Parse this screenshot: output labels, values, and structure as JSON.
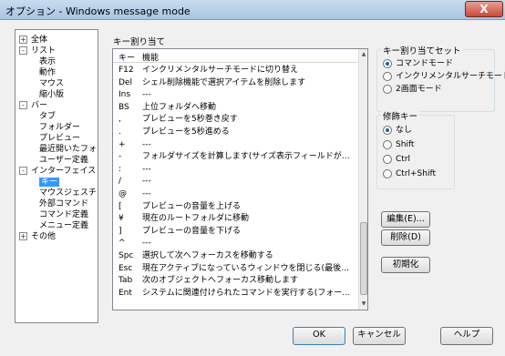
{
  "window": {
    "title": "オプション - Windows message mode",
    "close_glyph": "X"
  },
  "tree": {
    "items": [
      {
        "label": "全体",
        "level": 0,
        "expander": "+"
      },
      {
        "label": "リスト",
        "level": 0,
        "expander": "-"
      },
      {
        "label": "表示",
        "level": 1
      },
      {
        "label": "動作",
        "level": 1
      },
      {
        "label": "マウス",
        "level": 1
      },
      {
        "label": "縮小版",
        "level": 1
      },
      {
        "label": "バー",
        "level": 0,
        "expander": "-"
      },
      {
        "label": "タブ",
        "level": 1
      },
      {
        "label": "フォルダー",
        "level": 1
      },
      {
        "label": "プレビュー",
        "level": 1
      },
      {
        "label": "最近開いたフォルダ",
        "level": 1
      },
      {
        "label": "ユーザー定義",
        "level": 1
      },
      {
        "label": "インターフェイス",
        "level": 0,
        "expander": "-"
      },
      {
        "label": "キー",
        "level": 1,
        "selected": true
      },
      {
        "label": "マウスジェスチャ",
        "level": 1
      },
      {
        "label": "外部コマンド",
        "level": 1
      },
      {
        "label": "コマンド定義",
        "level": 1
      },
      {
        "label": "メニュー定義",
        "level": 1
      },
      {
        "label": "その他",
        "level": 0,
        "expander": "+"
      }
    ]
  },
  "keylist": {
    "label": "キー割り当て",
    "columns": {
      "key": "キー",
      "function": "機能"
    },
    "rows": [
      {
        "key": "F12",
        "function": "インクリメンタルサーチモードに切り替え"
      },
      {
        "key": "Del",
        "function": "シェル削除機能で選択アイテムを削除します"
      },
      {
        "key": "Ins",
        "function": "---"
      },
      {
        "key": "BS",
        "function": "上位フォルダへ移動"
      },
      {
        "key": ",",
        "function": "プレビューを5秒巻き戻す"
      },
      {
        "key": ".",
        "function": "プレビューを5秒進める"
      },
      {
        "key": "+",
        "function": "---"
      },
      {
        "key": "-",
        "function": "フォルダサイズを計算します(サイズ表示フィールドがある場合に..."
      },
      {
        "key": ":",
        "function": "---"
      },
      {
        "key": "/",
        "function": "---"
      },
      {
        "key": "@",
        "function": "---"
      },
      {
        "key": "[",
        "function": "プレビューの音量を上げる"
      },
      {
        "key": "¥",
        "function": "現在のルートフォルダに移動"
      },
      {
        "key": "]",
        "function": "プレビューの音量を下げる"
      },
      {
        "key": "^",
        "function": "---"
      },
      {
        "key": "Spc",
        "function": "選択して次へフォーカスを移動する"
      },
      {
        "key": "Esc",
        "function": "現在アクティブになっているウィンドウを閉じる(最後の一つであれ..."
      },
      {
        "key": "Tab",
        "function": "次のオブジェクトへフォーカス移動します"
      },
      {
        "key": "Ent",
        "function": "システムに関連付けられたコマンドを実行する(フォーカスナビゲー..."
      }
    ]
  },
  "keyset_group": {
    "label": "キー割り当てセット",
    "options": [
      "コマンドモード",
      "インクリメンタルサーチモード",
      "2画面モード"
    ],
    "selected_index": 0
  },
  "modifier_group": {
    "label": "修飾キー",
    "options": [
      "なし",
      "Shift",
      "Ctrl",
      "Ctrl+Shift"
    ],
    "selected_index": 0
  },
  "actions": {
    "edit": "編集(E)...",
    "delete": "削除(D)",
    "reset": "初期化"
  },
  "footer": {
    "ok": "OK",
    "cancel": "キャンセル",
    "help": "ヘルプ"
  }
}
